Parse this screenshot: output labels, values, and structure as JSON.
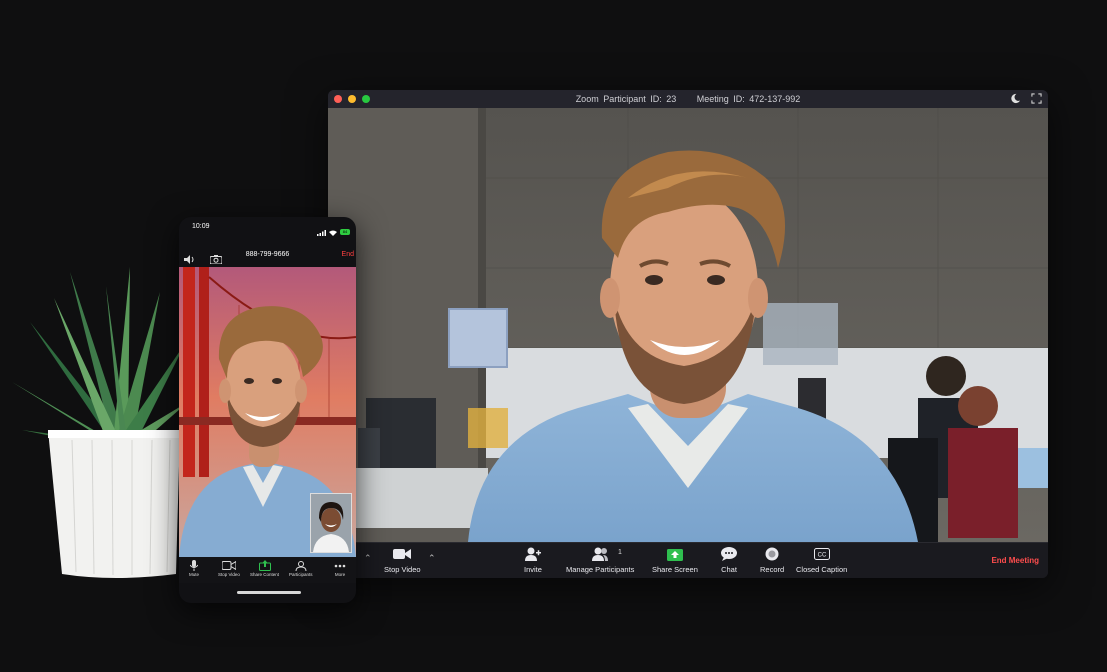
{
  "window": {
    "participant_id": "Zoom Participant ID: 23",
    "meeting_id": "Meeting ID: 472-137-992"
  },
  "toolbar": {
    "stop_video": "Stop Video",
    "invite": "Invite",
    "manage_participants": "Manage Participants",
    "participant_count": "1",
    "share_screen": "Share Screen",
    "chat": "Chat",
    "record": "Record",
    "closed_caption": "Closed Caption",
    "end_meeting": "End Meeting"
  },
  "phone": {
    "time": "10:09",
    "number": "888-799-9666",
    "end": "End",
    "battery": "84",
    "toolbar": {
      "mute": "Mute",
      "stop_video": "Stop Video",
      "share_content": "Share Content",
      "participants": "Participants",
      "more": "More"
    }
  },
  "colors": {
    "share_green": "#2fbf4f",
    "end_red": "#ff4d4d",
    "background": "#0f0f10"
  }
}
